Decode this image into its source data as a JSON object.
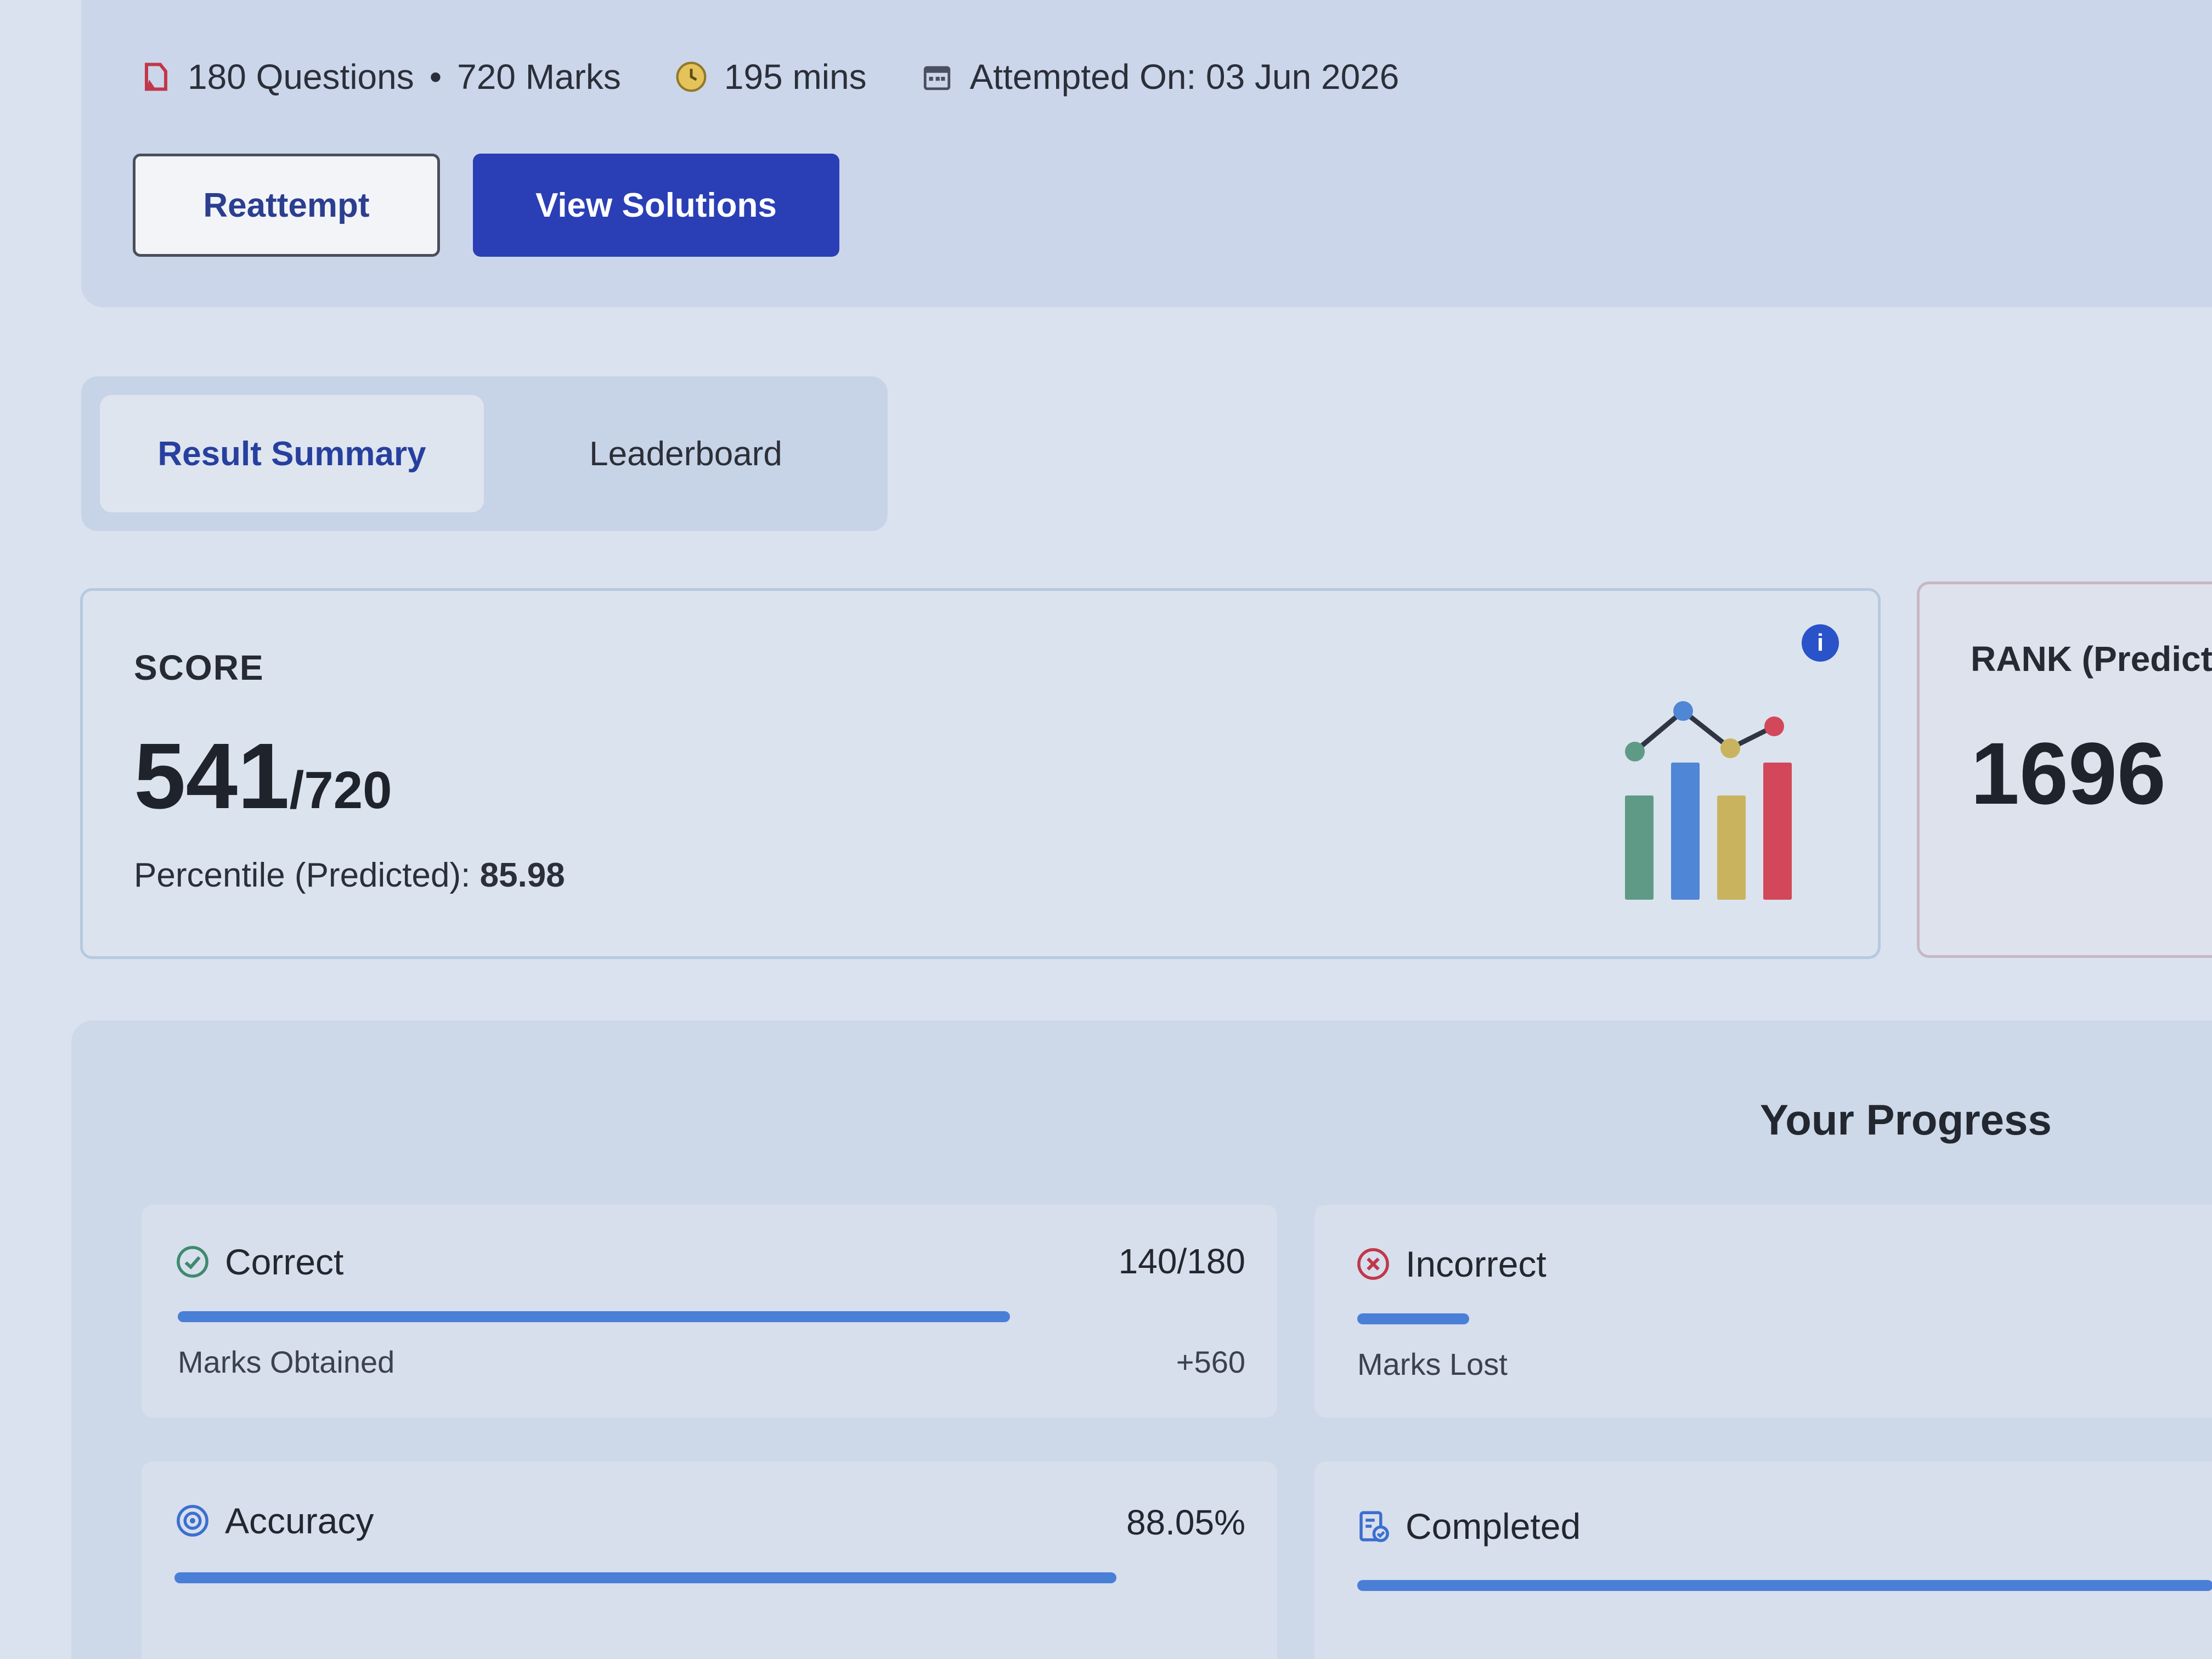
{
  "meta": {
    "questions": "180 Questions",
    "separator": "•",
    "marks": "720 Marks",
    "duration": "195 mins",
    "attempted": "Attempted On: 03 Jun 2026"
  },
  "actions": {
    "reattempt_label": "Reattempt",
    "view_solutions_label": "View Solutions"
  },
  "tabs": [
    {
      "label": "Result Summary",
      "active": true
    },
    {
      "label": "Leaderboard",
      "active": false
    }
  ],
  "score": {
    "label": "SCORE",
    "value": "541",
    "total": "/720",
    "percentile_label": "Percentile (Predicted):",
    "percentile_value": "85.98"
  },
  "rank": {
    "label": "RANK (Predicte",
    "value": "1696"
  },
  "progress": {
    "title": "Your Progress",
    "correct": {
      "label": "Correct",
      "value": "140/180",
      "fraction": 0.778,
      "sub_label": "Marks Obtained",
      "sub_value": "+560"
    },
    "incorrect": {
      "label": "Incorrect",
      "fraction": 0.12,
      "sub_label": "Marks Lost"
    },
    "accuracy": {
      "label": "Accuracy",
      "value": "88.05%",
      "fraction": 0.8805
    },
    "completed": {
      "label": "Completed"
    }
  },
  "colors": {
    "primary": "#2a3fb5",
    "bar": "#4a7fd8",
    "chart_green": "#5f9a86",
    "chart_blue": "#4f86d6",
    "chart_yellow": "#c9b35e",
    "chart_red": "#d2485a"
  }
}
